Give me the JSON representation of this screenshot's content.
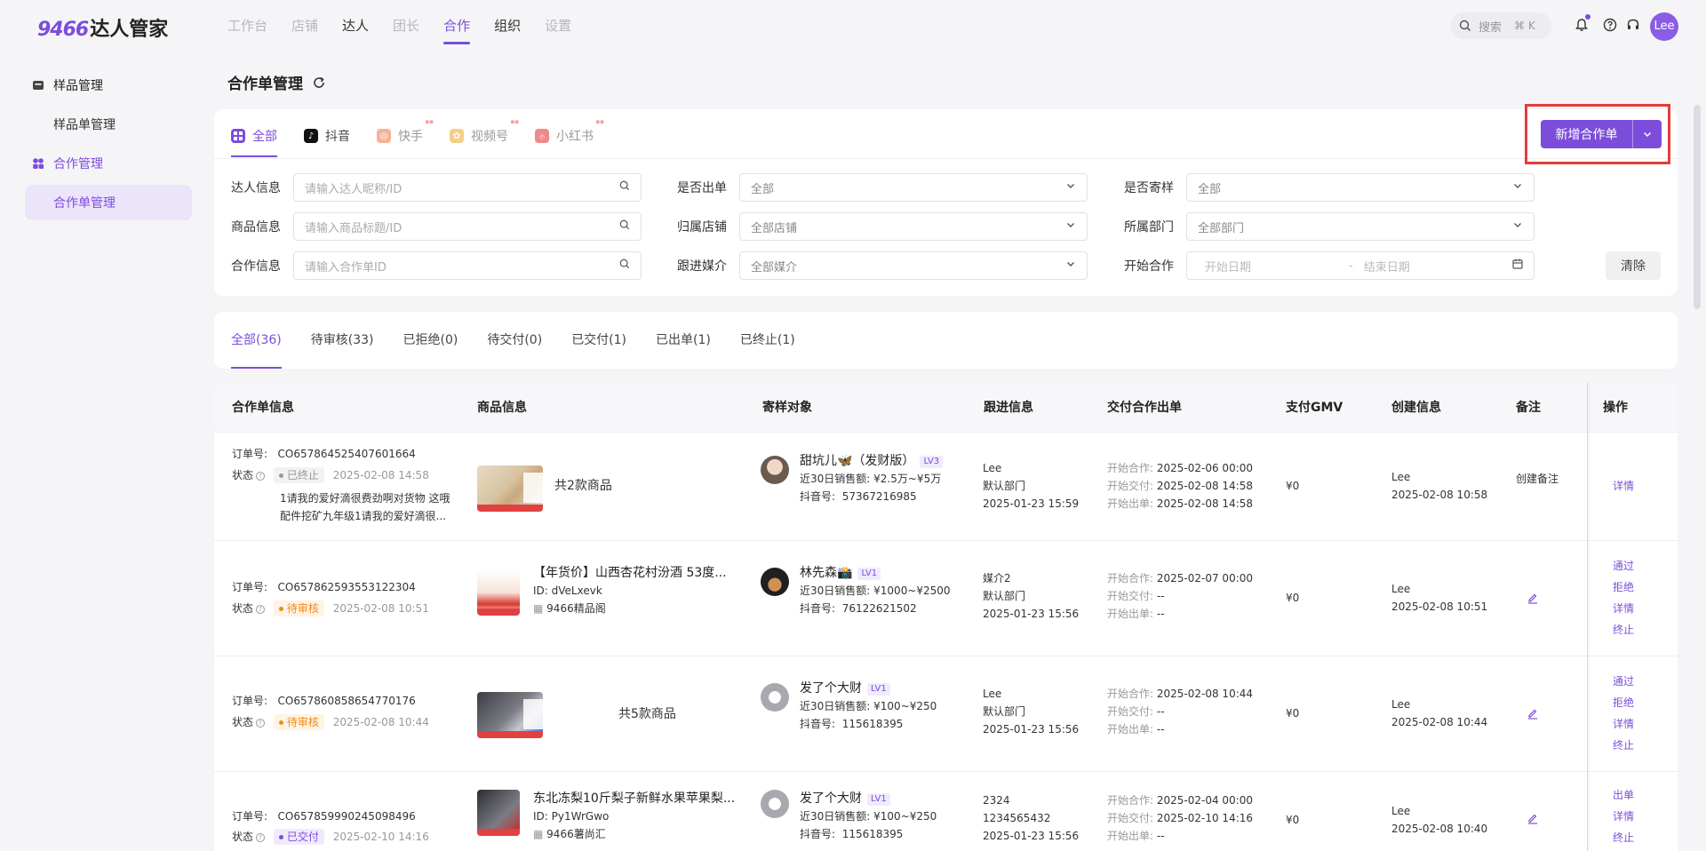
{
  "app": {
    "logo_num": "9466",
    "logo_text": "达人管家"
  },
  "nav": [
    {
      "label": "工作台",
      "state": "disabled"
    },
    {
      "label": "店铺",
      "state": "disabled"
    },
    {
      "label": "达人",
      "state": "enabled"
    },
    {
      "label": "团长",
      "state": "disabled"
    },
    {
      "label": "合作",
      "state": "active"
    },
    {
      "label": "组织",
      "state": "enabled"
    },
    {
      "label": "设置",
      "state": "disabled"
    }
  ],
  "topbar": {
    "search_label": "搜索",
    "search_shortcut": "⌘ K",
    "user": "Lee"
  },
  "sidebar": {
    "group1": "样品管理",
    "item1": "样品单管理",
    "group2": "合作管理",
    "item2": "合作单管理"
  },
  "page": {
    "title": "合作单管理"
  },
  "platforms": [
    "全部",
    "抖音",
    "快手",
    "视频号",
    "小红书"
  ],
  "add_button": "新增合作单",
  "filters": {
    "talent_label": "达人信息",
    "talent_placeholder": "请输入达人昵称/ID",
    "product_label": "商品信息",
    "product_placeholder": "请输入商品标题/ID",
    "coop_label": "合作信息",
    "coop_placeholder": "请输入合作单ID",
    "shipped_label": "是否出单",
    "shipped_value": "全部",
    "store_label": "归属店铺",
    "store_value": "全部店铺",
    "media_label": "跟进媒介",
    "media_value": "全部媒介",
    "sample_label": "是否寄样",
    "sample_value": "全部",
    "dept_label": "所属部门",
    "dept_value": "全部部门",
    "start_label": "开始合作",
    "start_placeholder": "开始日期",
    "date_sep": "-",
    "end_placeholder": "结束日期",
    "clear": "清除"
  },
  "status_tabs": [
    "全部(36)",
    "待审核(33)",
    "已拒绝(0)",
    "待交付(0)",
    "已交付(1)",
    "已出单(1)",
    "已终止(1)"
  ],
  "columns": [
    "合作单信息",
    "商品信息",
    "寄样对象",
    "跟进信息",
    "交付合作出单",
    "支付GMV",
    "创建信息",
    "备注",
    "操作"
  ],
  "labels": {
    "order_no": "订单号:",
    "status": "状态",
    "sales30": "近30日销售额:",
    "douyin_no": "抖音号:",
    "start_coop": "开始合作:",
    "start_deliver": "开始交付:",
    "start_ship": "开始出单:",
    "id_prefix": "ID:"
  },
  "rows": [
    {
      "order_no": "CO6578645254076016​64",
      "status": "已终止",
      "status_time": "2025-02-08 14:58",
      "note_text": "1请我的爱好滴很费劲啊对货物 这哦配件挖矿九年级1请我的爱好滴很...",
      "product": "共2款商品",
      "talent_name": "甜坑儿🦋（发财版）",
      "talent_lv": "LV3",
      "talent_sales": "¥2.5万~¥5万",
      "talent_dy": "57367216985",
      "follow_1": "Lee",
      "follow_2": "默认部门",
      "follow_3": "2025-01-23 15:59",
      "coop": "2025-02-06 00:00",
      "deliver": "2025-02-08 14:58",
      "ship": "2025-02-08 14:58",
      "gmv": "¥0",
      "creator": "Lee",
      "created": "2025-02-08 10:58",
      "remark": "创建备注",
      "ops": [
        "详情"
      ]
    },
    {
      "order_no": "CO657862593553122304",
      "status": "待审核",
      "status_time": "2025-02-08 10:51",
      "product_title": "【年货价】山西杏花村汾酒 53度...",
      "product_id": "dVeLxevk",
      "product_store": "9466精品阁",
      "talent_name": "林先森📸",
      "talent_lv": "LV1",
      "talent_sales": "¥1000~¥2500",
      "talent_dy": "76122621502",
      "follow_1": "媒介2",
      "follow_2": "默认部门",
      "follow_3": "2025-01-23 15:56",
      "coop": "2025-02-07 00:00",
      "deliver": "--",
      "ship": "--",
      "gmv": "¥0",
      "creator": "Lee",
      "created": "2025-02-08 10:51",
      "ops": [
        "通过",
        "拒绝",
        "详情",
        "终止"
      ]
    },
    {
      "order_no": "CO657860858654770176",
      "status": "待审核",
      "status_time": "2025-02-08 10:44",
      "product": "共5款商品",
      "talent_name": "发了个大财",
      "talent_lv": "LV1",
      "talent_sales": "¥100~¥250",
      "talent_dy": "115618395",
      "follow_1": "Lee",
      "follow_2": "默认部门",
      "follow_3": "2025-01-23 15:56",
      "coop": "2025-02-08 10:44",
      "deliver": "--",
      "ship": "--",
      "gmv": "¥0",
      "creator": "Lee",
      "created": "2025-02-08 10:44",
      "ops": [
        "通过",
        "拒绝",
        "详情",
        "终止"
      ]
    },
    {
      "order_no": "CO657859990245098496",
      "status": "已交付",
      "status_time": "2025-02-10 14:16",
      "product_title": "东北冻梨10斤梨子新鲜水果苹果梨...",
      "product_id": "Py1WrGwo",
      "product_store": "9466薯尚汇",
      "talent_name": "发了个大财",
      "talent_lv": "LV1",
      "talent_sales": "¥100~¥250",
      "talent_dy": "115618395",
      "follow_1": "2324",
      "follow_2": "1234565432",
      "follow_3": "2025-01-23 15:56",
      "coop": "2025-02-04 00:00",
      "deliver": "2025-02-10 14:16",
      "ship": "--",
      "gmv": "¥0",
      "creator": "Lee",
      "created": "2025-02-08 10:40",
      "ops": [
        "出单",
        "详情",
        "终止"
      ]
    }
  ],
  "colors": {
    "accent": "#7c4ddb",
    "highlight_box": "#e43c3c"
  }
}
